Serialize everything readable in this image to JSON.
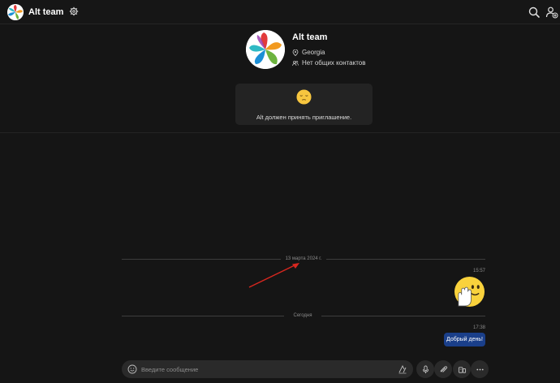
{
  "header": {
    "title": "Alt team",
    "icons": [
      "settings-gear-icon",
      "search-icon",
      "add-contact-icon"
    ]
  },
  "profile": {
    "name": "Alt team",
    "location": "Georgia",
    "contacts": "Нет общих контактов"
  },
  "invite": {
    "emoji": "sleepy-face-icon",
    "text": "Alt должен принять приглашение."
  },
  "conversation": {
    "separators": [
      {
        "label": "13 марта 2024 г."
      },
      {
        "label": "Сегодня"
      }
    ],
    "messages": [
      {
        "time": "15:57",
        "type": "sticker",
        "sticker": "waving-hand-face-icon"
      },
      {
        "time": "17:38",
        "type": "text",
        "text": "Добрый день!"
      }
    ]
  },
  "composer": {
    "placeholder": "Введите сообщение",
    "buttons": [
      "emoji-icon",
      "format-icon",
      "microphone-icon",
      "attach-icon",
      "contact-card-icon",
      "more-icon"
    ]
  },
  "colors": {
    "background": "#151515",
    "panel": "#232323",
    "accent_bubble": "#1a3f8a",
    "annotation_arrow": "#d8271f"
  }
}
